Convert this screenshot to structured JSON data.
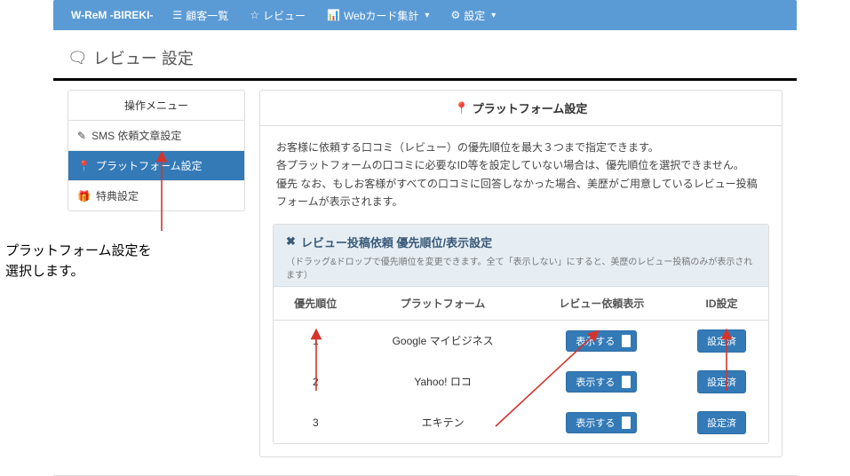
{
  "navbar": {
    "brand": "W-ReM -BIREKI-",
    "items": [
      {
        "icon": "list-icon",
        "glyph": "☰",
        "label": "顧客一覧"
      },
      {
        "icon": "star-icon",
        "glyph": "☆",
        "label": "レビュー"
      },
      {
        "icon": "chart-icon",
        "glyph": "📊",
        "label": "Webカード集計",
        "caret": true
      },
      {
        "icon": "gear-icon",
        "glyph": "⚙",
        "label": "設定",
        "caret": true
      }
    ]
  },
  "page_title": {
    "icon_glyph": "🗨",
    "text": "レビュー 設定"
  },
  "sidebar": {
    "title": "操作メニュー",
    "items": [
      {
        "icon": "pencil-icon",
        "glyph": "✎",
        "label": "SMS 依頼文章設定",
        "active": false
      },
      {
        "icon": "pin-icon",
        "glyph": "📍",
        "label": "プラットフォーム設定",
        "active": true
      },
      {
        "icon": "gift-icon",
        "glyph": "🎁",
        "label": "特典設定",
        "active": false
      }
    ]
  },
  "main": {
    "title_icon_glyph": "📍",
    "title": "プラットフォーム設定",
    "desc_lines": [
      "お客様に依頼する口コミ（レビュー）の優先順位を最大３つまで指定できます。",
      "各プラットフォームの口コミに必要なID等を設定していない場合は、優先順位を選択できません。",
      "優先 なお、もしお客様がすべての口コミに回答しなかった場合、美歴がご用意しているレビュー投稿フォームが表示されます。"
    ],
    "sub": {
      "icon_glyph": "✖",
      "title": "レビュー投稿依頼 優先順位/表示設定",
      "note": "（ドラッグ&ドロップで優先順位を変更できます。全て「表示しない」にすると、美歴のレビュー投稿のみが表示されます）",
      "columns": {
        "order": "優先順位",
        "platform": "プラットフォーム",
        "display": "レビュー依頼表示",
        "id": "ID設定"
      },
      "rows": [
        {
          "order": "1",
          "platform": "Google マイビジネス",
          "display": "表示する",
          "id": "設定済"
        },
        {
          "order": "2",
          "platform": "Yahoo! ロコ",
          "display": "表示する",
          "id": "設定済"
        },
        {
          "order": "3",
          "platform": "エキテン",
          "display": "表示する",
          "id": "設定済"
        }
      ]
    }
  },
  "annotations": {
    "side_text_l1": "プラットフォーム設定を",
    "side_text_l2": "選択します。"
  },
  "colors": {
    "navbar_bg": "#5b9bd5",
    "primary_btn": "#337ab7",
    "arrow": "#d4342c"
  }
}
